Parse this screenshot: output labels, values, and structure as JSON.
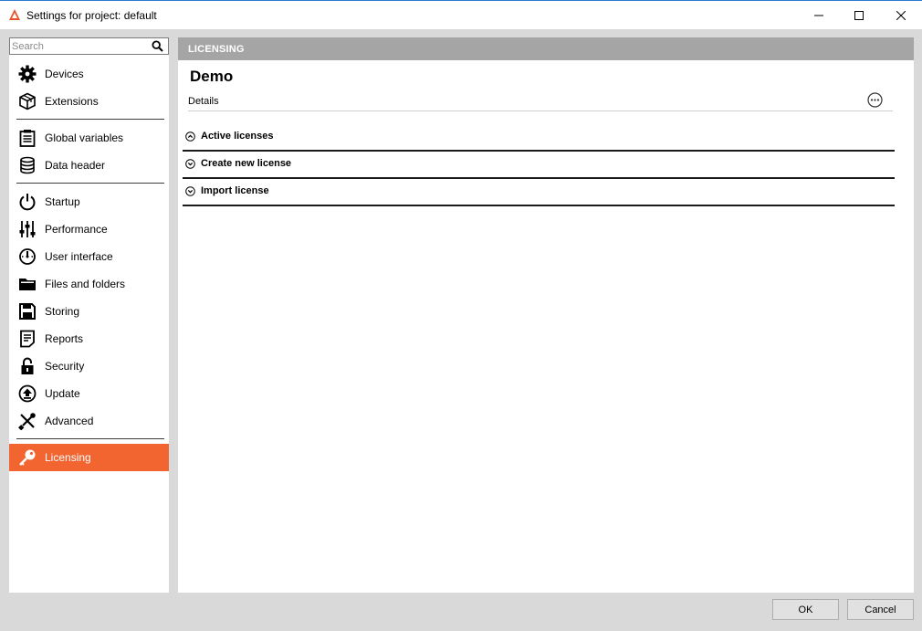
{
  "window": {
    "title": "Settings for project: default"
  },
  "search": {
    "placeholder": "Search",
    "value": ""
  },
  "sidebar": {
    "items": [
      {
        "label": "Devices",
        "icon": "gear-icon"
      },
      {
        "label": "Extensions",
        "icon": "cube-icon"
      },
      {
        "label": "Global variables",
        "icon": "clipboard-list-icon"
      },
      {
        "label": "Data header",
        "icon": "database-icon"
      },
      {
        "label": "Startup",
        "icon": "power-icon"
      },
      {
        "label": "Performance",
        "icon": "sliders-icon"
      },
      {
        "label": "User interface",
        "icon": "gauge-icon"
      },
      {
        "label": "Files and folders",
        "icon": "folder-icon"
      },
      {
        "label": "Storing",
        "icon": "floppy-disk-icon"
      },
      {
        "label": "Reports",
        "icon": "document-icon"
      },
      {
        "label": "Security",
        "icon": "padlock-icon"
      },
      {
        "label": "Update",
        "icon": "upload-circle-icon"
      },
      {
        "label": "Advanced",
        "icon": "wrench-screwdriver-icon"
      },
      {
        "label": "Licensing",
        "icon": "key-icon",
        "active": true
      }
    ]
  },
  "main": {
    "section_header": "LICENSING",
    "page_title": "Demo",
    "details_label": "Details",
    "sections": [
      {
        "label": "Active licenses",
        "expanded": true
      },
      {
        "label": "Create new license",
        "expanded": false
      },
      {
        "label": "Import license",
        "expanded": false
      }
    ]
  },
  "buttons": {
    "ok_label": "OK",
    "cancel_label": "Cancel"
  },
  "colors": {
    "accent": "#f26430",
    "header_gray": "#a5a5a5"
  }
}
